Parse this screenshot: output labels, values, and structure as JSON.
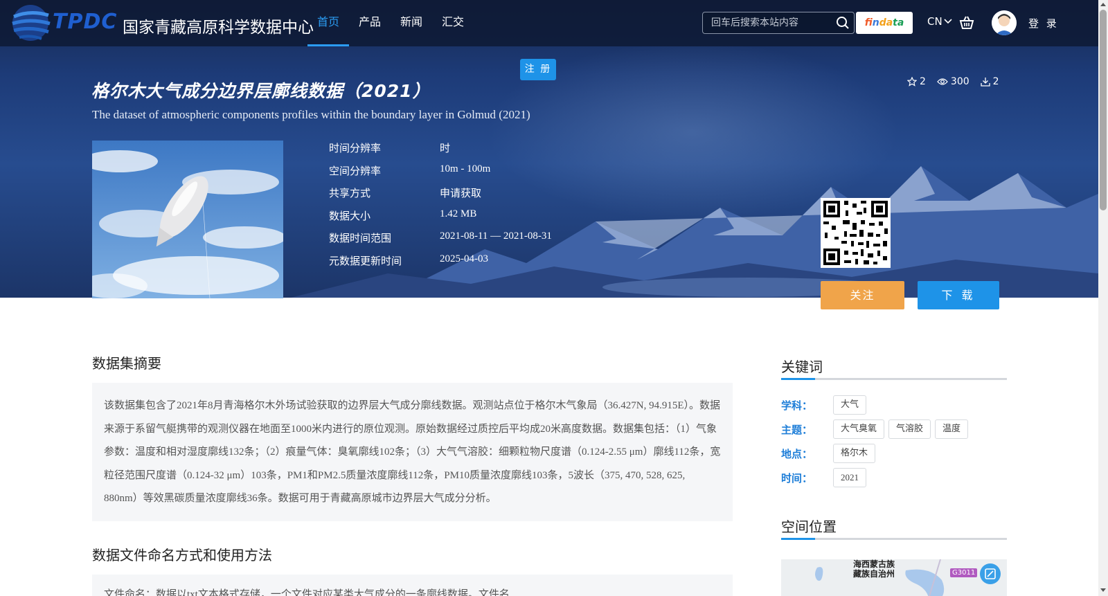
{
  "nav": {
    "logo_en": "TPDC",
    "logo_cn": "国家青藏高原科学数据中心",
    "menu": [
      {
        "label": "首页",
        "active": true
      },
      {
        "label": "产品",
        "active": false
      },
      {
        "label": "新闻",
        "active": false
      },
      {
        "label": "汇交",
        "active": false
      }
    ],
    "search_placeholder": "回车后搜索本站内容",
    "findata": [
      "f",
      "in",
      "da",
      "ta"
    ],
    "lang": "CN",
    "login": "登 录"
  },
  "dataset": {
    "register_label": "注 册",
    "title_cn": "格尔木大气成分边界层廓线数据（2021）",
    "title_en": "The dataset of atmospheric components profiles within the boundary layer in Golmud (2021)",
    "stats": {
      "favorites": "2",
      "views": "300",
      "downloads": "2"
    },
    "meta": [
      {
        "key": "时间分辨率",
        "value": "时"
      },
      {
        "key": "空间分辨率",
        "value": "10m - 100m"
      },
      {
        "key": "共享方式",
        "value": "申请获取"
      },
      {
        "key": "数据大小",
        "value": "1.42 MB"
      },
      {
        "key": "数据时间范围",
        "value": "2021-08-11 — 2021-08-31"
      },
      {
        "key": "元数据更新时间",
        "value": "2025-04-03"
      }
    ],
    "follow_label": "关注",
    "download_label": "下 载"
  },
  "main": {
    "abstract_title": "数据集摘要",
    "abstract_text": "该数据集包含了2021年8月青海格尔木外场试验获取的边界层大气成分廓线数据。观测站点位于格尔木气象局（36.427N, 94.915E）。数据来源于系留气艇携带的观测仪器在地面至1000米内进行的原位观测。原始数据经过质控后平均成20米高度数据。数据集包括：（1）气象参数：温度和相对湿度廓线132条；（2）痕量气体：臭氧廓线102条；（3）大气气溶胶：细颗粒物尺度谱（0.124-2.55 μm）廓线112条，宽粒径范围尺度谱（0.124-32 μm）103条，PM1和PM2.5质量浓度廓线112条，PM10质量浓度廓线103条，5波长（375, 470, 528, 625, 880nm）等效黑碳质量浓度廓线36条。数据可用于青藏高原城市边界层大气成分分析。",
    "naming_title": "数据文件命名方式和使用方法",
    "naming_text": "文件命名：数据以txt文本格式存储，一个文件对应某类大气成分的一条廓线数据。文件名"
  },
  "sidebar": {
    "keywords_title": "关键词",
    "keyword_groups": [
      {
        "label": "学科：",
        "tags": [
          "大气"
        ]
      },
      {
        "label": "主题：",
        "tags": [
          "大气臭氧",
          "气溶胶",
          "温度"
        ]
      },
      {
        "label": "地点：",
        "tags": [
          "格尔木"
        ]
      },
      {
        "label": "时间：",
        "tags": [
          "2021"
        ]
      }
    ],
    "location_title": "空间位置",
    "map_label_line1": "海西蒙古族",
    "map_label_line2": "藏族自治州",
    "map_road": "G3011"
  },
  "colors": {
    "accent": "#1e93e8",
    "follow": "#f0a44a",
    "nav_active": "#2b9cf2"
  }
}
